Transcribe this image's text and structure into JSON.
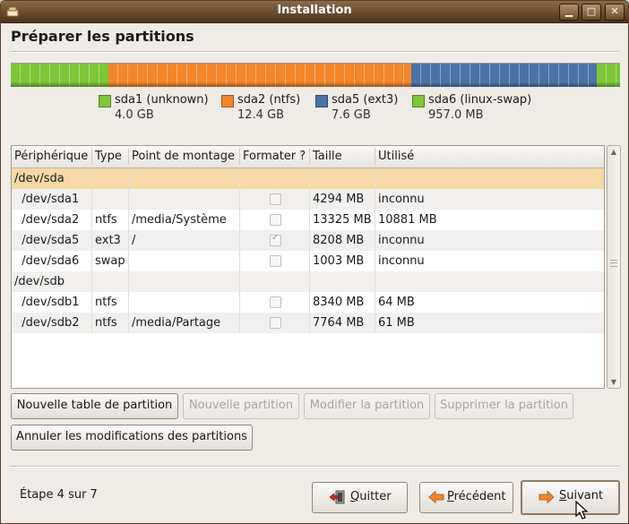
{
  "window": {
    "title": "Installation",
    "controls": {
      "minimize": "▁",
      "maximize": "□",
      "close": "✕"
    }
  },
  "page": {
    "heading": "Préparer les partitions"
  },
  "disk_bar": {
    "colors": {
      "unknown": "#7dc738",
      "ntfs": "#f3862b",
      "ext3": "#4a74a8",
      "swap": "#7dc738"
    },
    "segments": [
      {
        "kind": "unknown",
        "size_gb": 4.0
      },
      {
        "kind": "ntfs",
        "size_gb": 12.4
      },
      {
        "kind": "ext3",
        "size_gb": 7.6
      },
      {
        "kind": "swap",
        "size_gb": 0.957
      }
    ]
  },
  "legend": [
    {
      "name": "sda1 (unknown)",
      "size": "4.0 GB",
      "color": "#7dc738"
    },
    {
      "name": "sda2 (ntfs)",
      "size": "12.4 GB",
      "color": "#f3862b"
    },
    {
      "name": "sda5 (ext3)",
      "size": "7.6 GB",
      "color": "#4a74a8"
    },
    {
      "name": "sda6 (linux-swap)",
      "size": "957.0 MB",
      "color": "#7dc738"
    }
  ],
  "table": {
    "columns": [
      "Périphérique",
      "Type",
      "Point de montage",
      "Formater ?",
      "Taille",
      "Utilisé"
    ],
    "rows": [
      {
        "device": "/dev/sda",
        "type": "",
        "mount": "",
        "format": null,
        "size": "",
        "used": "",
        "selected": true
      },
      {
        "device": "  /dev/sda1",
        "type": "",
        "mount": "",
        "format": false,
        "size": "4294 MB",
        "used": "inconnu"
      },
      {
        "device": "  /dev/sda2",
        "type": "ntfs",
        "mount": "/media/Système",
        "format": false,
        "size": "13325 MB",
        "used": "10881 MB"
      },
      {
        "device": "  /dev/sda5",
        "type": "ext3",
        "mount": "/",
        "format": true,
        "size": "8208 MB",
        "used": "inconnu"
      },
      {
        "device": "  /dev/sda6",
        "type": "swap",
        "mount": "",
        "format": false,
        "size": "1003 MB",
        "used": "inconnu"
      },
      {
        "device": "/dev/sdb",
        "type": "",
        "mount": "",
        "format": null,
        "size": "",
        "used": ""
      },
      {
        "device": "  /dev/sdb1",
        "type": "ntfs",
        "mount": "",
        "format": false,
        "size": "8340 MB",
        "used": "64 MB"
      },
      {
        "device": "  /dev/sdb2",
        "type": "ntfs",
        "mount": "/media/Partage",
        "format": false,
        "size": "7764 MB",
        "used": "61 MB"
      }
    ]
  },
  "actions": {
    "new_table": "Nouvelle table de partition",
    "new_partition": "Nouvelle partition",
    "modify_partition": "Modifier la partition",
    "delete_partition": "Supprimer la partition",
    "revert": "Annuler les modifications des partitions"
  },
  "footer": {
    "step": "Étape 4 sur 7",
    "quit_u": "Q",
    "quit_rest": "uitter",
    "back_u": "P",
    "back_rest": "récédent",
    "next_u": "S",
    "next_rest": "uivant"
  }
}
